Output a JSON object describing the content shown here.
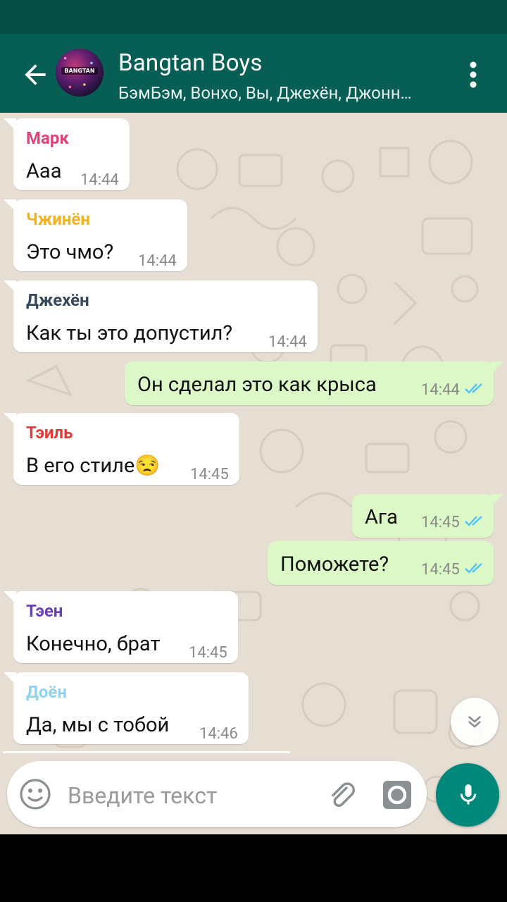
{
  "header": {
    "title": "Bangtan Boys",
    "subtitle": "БэмБэм, Вонхо, Вы, Джехён, Джонн…",
    "avatar_label": "BANGTAN"
  },
  "messages": [
    {
      "sender": "Марк",
      "sender_color": "#e0427a",
      "text": "Ааа",
      "time": "14:44",
      "direction": "in"
    },
    {
      "sender": "Чжинён",
      "sender_color": "#f2b31c",
      "text": "Это чмо?",
      "time": "14:44",
      "direction": "in"
    },
    {
      "sender": "Джехён",
      "sender_color": "#34495e",
      "text": "Как ты это допустил?",
      "time": "14:44",
      "direction": "in"
    },
    {
      "text": "Он сделал это как крыса",
      "time": "14:44",
      "direction": "out",
      "status": "read"
    },
    {
      "sender": "Тэиль",
      "sender_color": "#e53935",
      "text": "В его стиле😒",
      "time": "14:45",
      "direction": "in"
    },
    {
      "text": "Ага",
      "time": "14:45",
      "direction": "out",
      "status": "read"
    },
    {
      "text": "Поможете?",
      "time": "14:45",
      "direction": "out",
      "status": "read"
    },
    {
      "sender": "Тэен",
      "sender_color": "#6a3fb5",
      "text": "Конечно, брат",
      "time": "14:45",
      "direction": "in"
    },
    {
      "sender": "Доён",
      "sender_color": "#8fd3f0",
      "text": "Да, мы с тобой",
      "time": "14:46",
      "direction": "in"
    }
  ],
  "input": {
    "placeholder": "Введите текст"
  },
  "colors": {
    "header": "#075e54",
    "statusbar": "#054d44",
    "chat_bg": "#e6ded3",
    "outgoing_bubble": "#dcf8c6",
    "read_ticks": "#4fc3f7",
    "fab": "#00897b"
  },
  "icons": [
    "back-arrow-icon",
    "more-vert-icon",
    "emoji-icon",
    "attach-icon",
    "camera-icon",
    "mic-icon",
    "chevron-down-icon",
    "read-ticks-icon"
  ]
}
